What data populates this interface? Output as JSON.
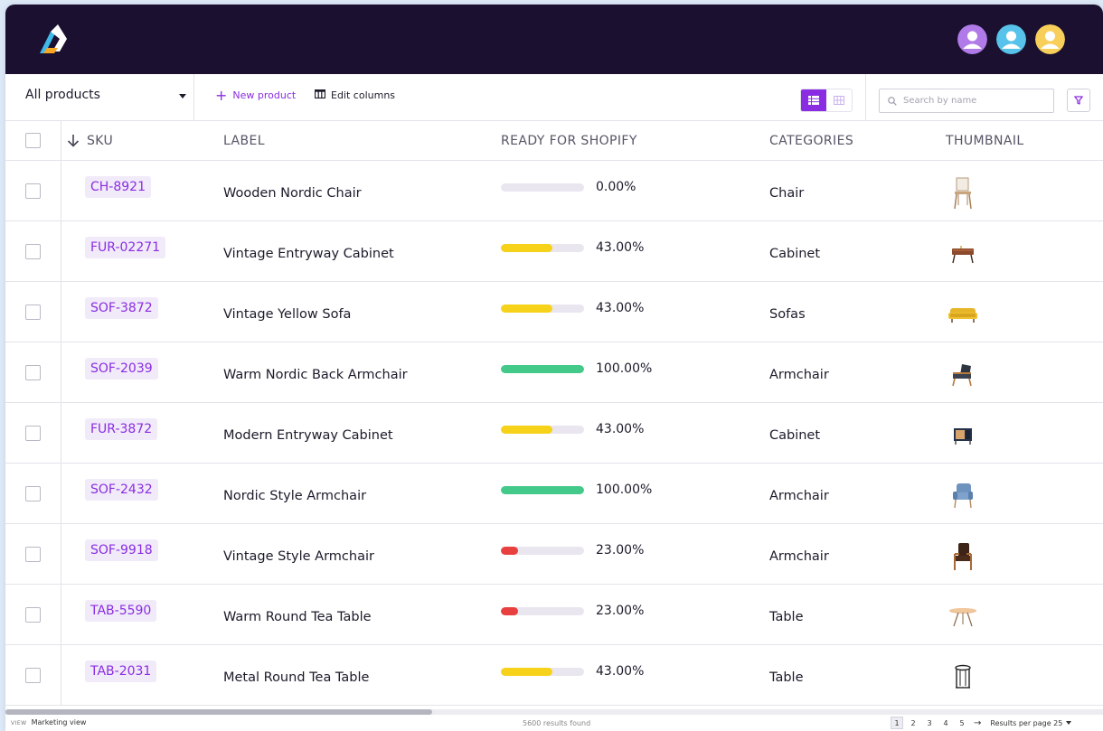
{
  "toolbar": {
    "view_select": "All products",
    "new_product_label": "New product",
    "edit_columns_label": "Edit columns",
    "search_placeholder": "Search by name"
  },
  "table": {
    "headers": {
      "sku": "SKU",
      "label": "LABEL",
      "ready": "READY FOR SHOPIFY",
      "categories": "CATEGORIES",
      "thumbnail": "THUMBNAIL"
    },
    "rows": [
      {
        "sku": "CH-8921",
        "label": "Wooden Nordic Chair",
        "ready": "0.00%",
        "ready_value": 0,
        "category": "Chair",
        "thumb_icon": "wooden-chair-icon"
      },
      {
        "sku": "FUR-02271",
        "label": "Vintage Entryway Cabinet",
        "ready": "43.00%",
        "ready_value": 43,
        "category": "Cabinet",
        "thumb_icon": "cabinet-icon"
      },
      {
        "sku": "SOF-3872",
        "label": "Vintage Yellow Sofa",
        "ready": "43.00%",
        "ready_value": 43,
        "category": "Sofas",
        "thumb_icon": "sofa-icon"
      },
      {
        "sku": "SOF-2039",
        "label": "Warm Nordic Back Armchair",
        "ready": "100.00%",
        "ready_value": 100,
        "category": "Armchair",
        "thumb_icon": "armchair-icon"
      },
      {
        "sku": "FUR-3872",
        "label": "Modern Entryway Cabinet",
        "ready": "43.00%",
        "ready_value": 43,
        "category": "Cabinet",
        "thumb_icon": "modern-cabinet-icon"
      },
      {
        "sku": "SOF-2432",
        "label": "Nordic Style Armchair",
        "ready": "100.00%",
        "ready_value": 100,
        "category": "Armchair",
        "thumb_icon": "blue-armchair-icon"
      },
      {
        "sku": "SOF-9918",
        "label": "Vintage Style Armchair",
        "ready": "23.00%",
        "ready_value": 23,
        "category": "Armchair",
        "thumb_icon": "vintage-armchair-icon"
      },
      {
        "sku": "TAB-5590",
        "label": "Warm Round Tea Table",
        "ready": "23.00%",
        "ready_value": 23,
        "category": "Table",
        "thumb_icon": "round-table-icon"
      },
      {
        "sku": "TAB-2031",
        "label": "Metal Round Tea Table",
        "ready": "43.00%",
        "ready_value": 43,
        "category": "Table",
        "thumb_icon": "metal-table-icon"
      }
    ]
  },
  "footer": {
    "view_prefix": "VIEW",
    "view_name": "Marketing view",
    "results": "5600 results found",
    "pages": [
      "1",
      "2",
      "3",
      "4",
      "5"
    ],
    "current_page": "1",
    "results_per_page": "Results per page 25"
  },
  "colors": {
    "accent": "#8a2de2",
    "progress_low": "#e8403f",
    "progress_mid": "#f7d21b",
    "progress_full": "#43c98a",
    "topbar": "#1b1030"
  }
}
